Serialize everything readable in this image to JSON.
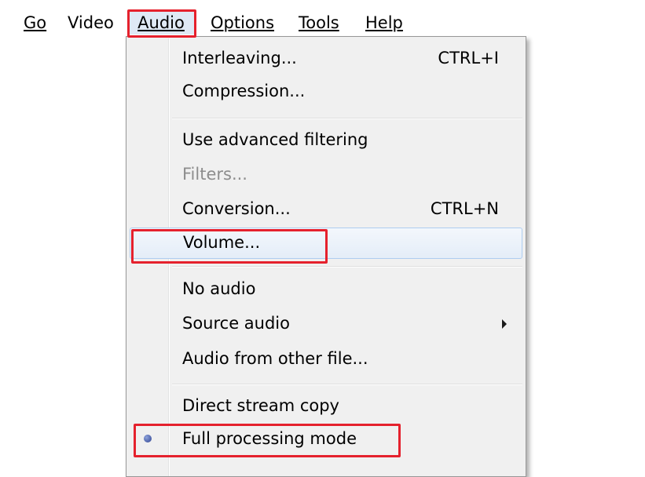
{
  "menubar": {
    "go": "Go",
    "video": "Video",
    "audio": "Audio",
    "options": "Options",
    "tools": "Tools",
    "help": "Help"
  },
  "audio_menu": {
    "interleaving": {
      "label": "Interleaving...",
      "shortcut": "CTRL+I"
    },
    "compression": {
      "label": "Compression..."
    },
    "advanced_filtering": {
      "label": "Use advanced filtering"
    },
    "filters": {
      "label": "Filters..."
    },
    "conversion": {
      "label": "Conversion...",
      "shortcut": "CTRL+N"
    },
    "volume": {
      "label": "Volume..."
    },
    "no_audio": {
      "label": "No audio"
    },
    "source_audio": {
      "label": "Source audio"
    },
    "audio_other_file": {
      "label": "Audio from other file..."
    },
    "direct_stream_copy": {
      "label": "Direct stream copy"
    },
    "full_processing": {
      "label": "Full processing mode"
    }
  },
  "colors": {
    "highlight_red": "#e5212d",
    "hover_border": "#aecdf0",
    "menu_bg": "#f0f0f0",
    "disabled_text": "#8d8d8d"
  },
  "icons": {
    "submenu_arrow": "chevron-right-icon",
    "radio": "radio-selected-icon"
  }
}
